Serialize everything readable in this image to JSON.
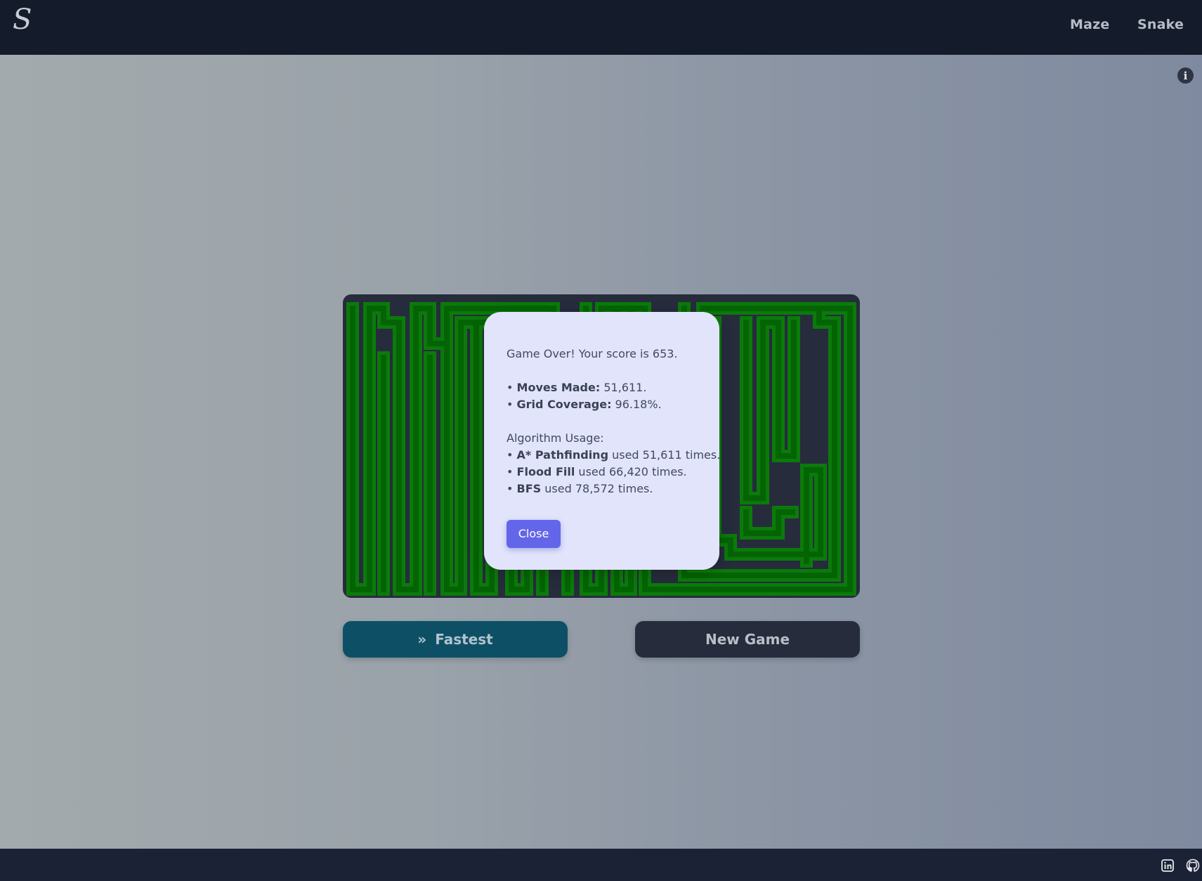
{
  "header": {
    "logo_text": "S",
    "nav": [
      {
        "label": "Maze"
      },
      {
        "label": "Snake"
      }
    ],
    "info_icon": "i"
  },
  "game": {
    "board_bg": "#262c3c",
    "snake_color": "#0b7a0b",
    "snake_core_color": "#046404"
  },
  "controls": {
    "fastest_label": "Fastest",
    "fastest_icon": "»",
    "new_game_label": "New Game"
  },
  "modal": {
    "score_line": "Game Over! Your score is 653.",
    "moves_label": "Moves Made:",
    "moves_value": " 51,611.",
    "coverage_label": "Grid Coverage:",
    "coverage_value": " 96.18%.",
    "algo_heading": "Algorithm Usage:",
    "algorithms": [
      {
        "name": "A* Pathfinding",
        "text": " used 51,611 times."
      },
      {
        "name": "Flood Fill",
        "text": " used 66,420 times."
      },
      {
        "name": "BFS",
        "text": " used 78,572 times."
      }
    ],
    "bullet": "• ",
    "close_label": "Close"
  },
  "footer": {
    "icons": [
      "linkedin-icon",
      "github-icon"
    ]
  }
}
